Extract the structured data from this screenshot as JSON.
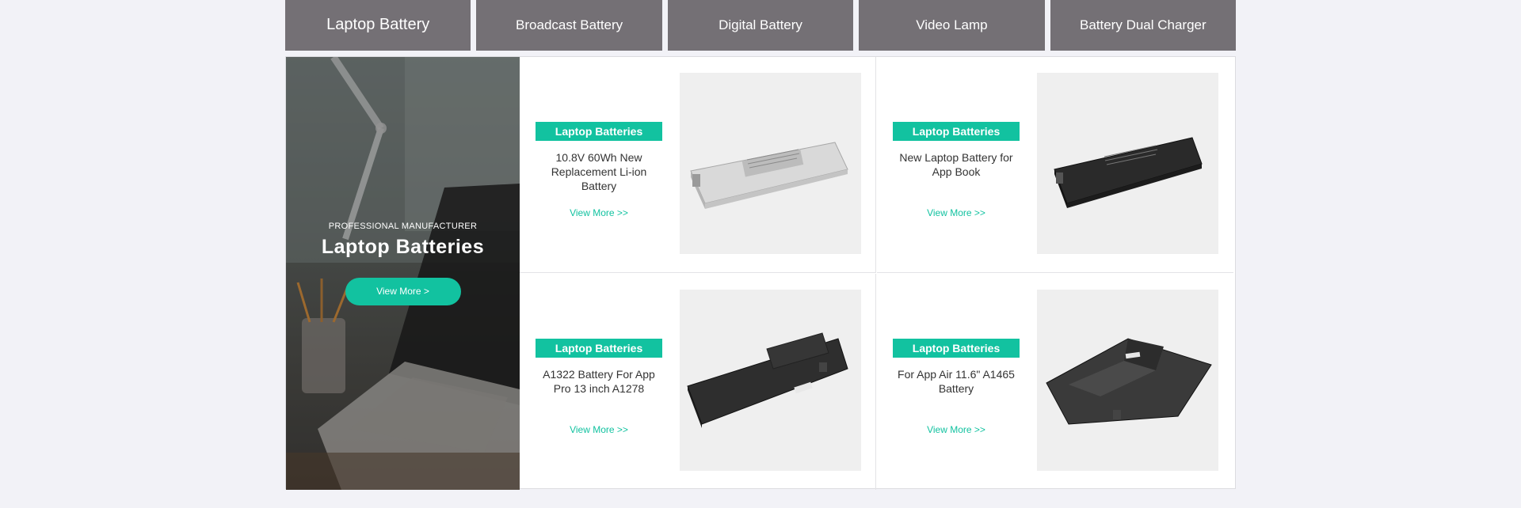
{
  "tabs": [
    {
      "label": "Laptop Battery",
      "active": true
    },
    {
      "label": "Broadcast Battery",
      "active": false
    },
    {
      "label": "Digital Battery",
      "active": false
    },
    {
      "label": "Video Lamp",
      "active": false
    },
    {
      "label": "Battery Dual Charger",
      "active": false
    }
  ],
  "hero": {
    "kicker": "PROFESSIONAL MANUFACTURER",
    "title": "Laptop Batteries",
    "button": "View More >"
  },
  "products": [
    {
      "category": "Laptop Batteries",
      "name": "10.8V 60Wh New Replacement Li-ion Battery",
      "link": "View More >>",
      "image": "silver-laptop-battery"
    },
    {
      "category": "Laptop Batteries",
      "name": "New Laptop Battery for App Book",
      "link": "View More >>",
      "image": "black-laptop-battery"
    },
    {
      "category": "Laptop Batteries",
      "name": "A1322 Battery For App Pro 13 inch A1278",
      "link": "View More >>",
      "image": "internal-battery-a1322"
    },
    {
      "category": "Laptop Batteries",
      "name": "For App Air 11.6\" A1465 Battery",
      "link": "View More >>",
      "image": "internal-battery-a1465"
    }
  ],
  "colors": {
    "accent": "#12c2a0",
    "tab_bg": "#747075",
    "page_bg": "#f2f2f7"
  }
}
